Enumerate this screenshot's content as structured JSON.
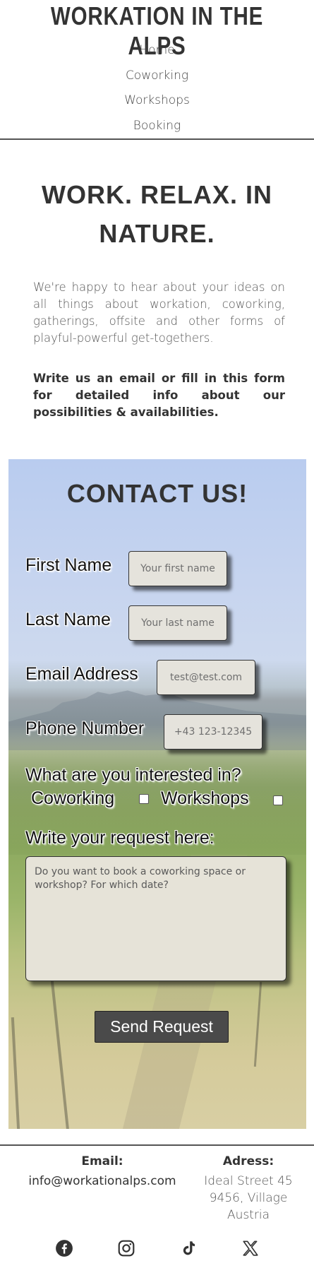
{
  "header": {
    "site_title": "WORKATION IN THE ALPS",
    "nav": [
      "Home",
      "Coworking",
      "Workshops",
      "Booking"
    ]
  },
  "intro": {
    "title": "WORK. RELAX. IN NATURE.",
    "text": "We're happy to hear about your ideas on all things about workation, coworking, gatherings, offsite and other forms of playful-powerful get-togethers.",
    "cta": "Write us an email or fill in this form for detailed info about our possibilities & availabilities."
  },
  "contact": {
    "title": "CONTACT US!",
    "first_name_label": "First Name",
    "first_name_placeholder": "Your first name",
    "last_name_label": "Last Name",
    "last_name_placeholder": "Your last name",
    "email_label": "Email Address",
    "email_placeholder": "test@test.com",
    "phone_label": "Phone Number",
    "phone_placeholder": "+43 123-12345",
    "interest_label": "What are you interested in?",
    "option_coworking": "Coworking",
    "option_workshops": "Workshops",
    "request_label": "Write your request here:",
    "request_placeholder": "Do you want to book a coworking space or workshop? For which date?",
    "send_label": "Send Request"
  },
  "footer": {
    "email_heading": "Email:",
    "email_value": "info@workationalps.com",
    "address_heading": "Adress:",
    "address_lines": [
      "Ideal Street 45",
      "9456, Village",
      "Austria"
    ],
    "social_icons": [
      "facebook-icon",
      "instagram-icon",
      "tiktok-icon",
      "x-icon"
    ]
  },
  "colors": {
    "text_dark": "#333333",
    "button_bg": "#4a4a4a",
    "field_bg": "#e5e3dc"
  }
}
